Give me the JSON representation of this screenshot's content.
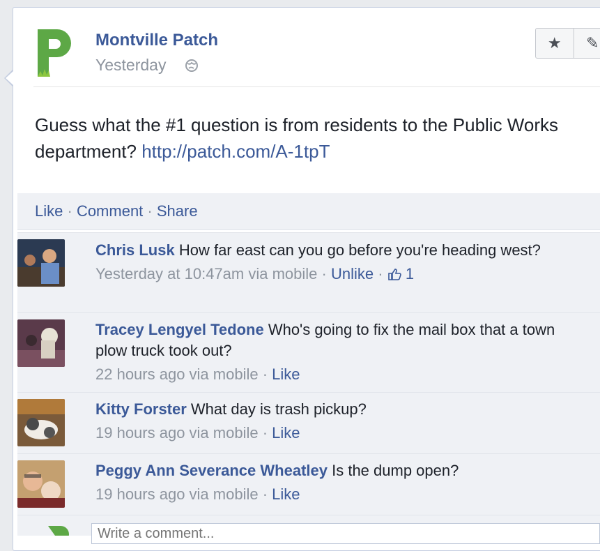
{
  "post": {
    "author": "Montville Patch",
    "time": "Yesterday",
    "message": "Guess what the #1 question is from residents to the Public Works department?",
    "link": "http://patch.com/A-1tpT",
    "logo_letter": "P"
  },
  "toolbar": {
    "star_icon": "★",
    "edit_icon": "✎"
  },
  "actions": {
    "like": "Like",
    "comment": "Comment",
    "share": "Share",
    "separator": "·"
  },
  "comments": [
    {
      "name": "Chris Lusk",
      "text": "How far east can you go before you're heading west?",
      "time": "Yesterday at 10:47am via mobile",
      "action": "Unlike",
      "likes": "1"
    },
    {
      "name": "Tracey Lengyel Tedone",
      "text": "Who's going to fix the mail box that a town plow truck took out?",
      "time": "22 hours ago via mobile",
      "action": "Like"
    },
    {
      "name": "Kitty Forster",
      "text": "What day is trash pickup?",
      "time": "19 hours ago via mobile",
      "action": "Like"
    },
    {
      "name": "Peggy Ann Severance Wheatley",
      "text": "Is the dump open?",
      "time": "19 hours ago via mobile",
      "action": "Like"
    }
  ],
  "composer": {
    "placeholder": "Write a comment..."
  },
  "colors": {
    "link": "#3b5998",
    "logo_green": "#5da846"
  }
}
